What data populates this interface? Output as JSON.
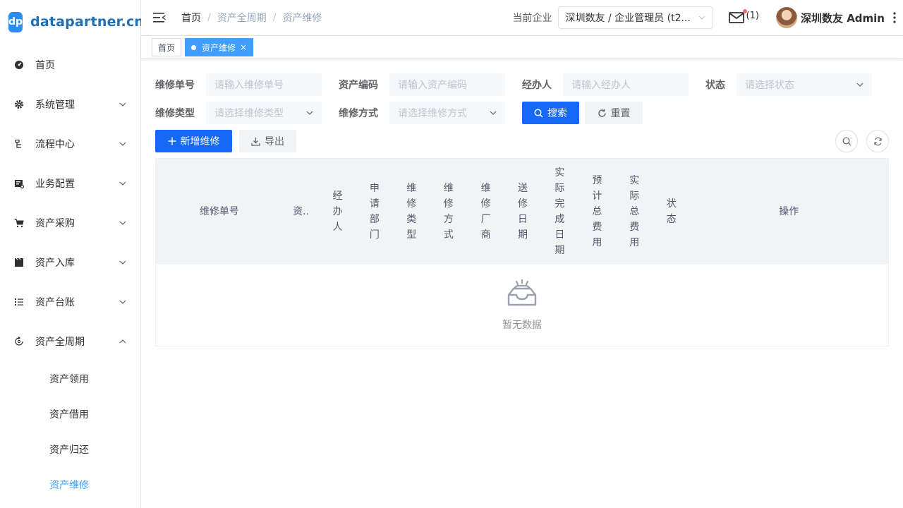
{
  "brand": {
    "mark": "dp",
    "name": "datapartner.cn"
  },
  "sidebar": {
    "items": [
      {
        "label": "首页",
        "icon": "dashboard-icon",
        "expandable": false
      },
      {
        "label": "系统管理",
        "icon": "gear-icon",
        "expandable": true
      },
      {
        "label": "流程中心",
        "icon": "flow-icon",
        "expandable": true
      },
      {
        "label": "业务配置",
        "icon": "config-icon",
        "expandable": true
      },
      {
        "label": "资产采购",
        "icon": "cart-icon",
        "expandable": true
      },
      {
        "label": "资产入库",
        "icon": "clapper-icon",
        "expandable": true
      },
      {
        "label": "资产台账",
        "icon": "list-icon",
        "expandable": true
      },
      {
        "label": "资产全周期",
        "icon": "cycle-icon",
        "expandable": true,
        "expanded": true
      }
    ],
    "subitems": [
      {
        "label": "资产领用",
        "active": false
      },
      {
        "label": "资产借用",
        "active": false
      },
      {
        "label": "资产归还",
        "active": false
      },
      {
        "label": "资产维修",
        "active": true
      }
    ]
  },
  "navbar": {
    "breadcrumb": [
      "首页",
      "资产全周期",
      "资产维修"
    ],
    "company_label": "当前企业",
    "company_value": "深圳数友 / 企业管理员 (t2...",
    "mail_count": "(1)",
    "user_name": "深圳数友 Admin"
  },
  "tags": [
    {
      "label": "首页",
      "active": false
    },
    {
      "label": "资产维修",
      "active": true,
      "close": "×"
    }
  ],
  "search": {
    "repair_no_label": "维修单号",
    "repair_no_placeholder": "请输入维修单号",
    "asset_code_label": "资产编码",
    "asset_code_placeholder": "请输入资产编码",
    "handler_label": "经办人",
    "handler_placeholder": "请输入经办人",
    "status_label": "状态",
    "status_placeholder": "请选择状态",
    "repair_type_label": "维修类型",
    "repair_type_placeholder": "请选择维修类型",
    "repair_method_label": "维修方式",
    "repair_method_placeholder": "请选择维修方式",
    "search_button": "搜索",
    "reset_button": "重置"
  },
  "toolbar": {
    "add_button": "新增维修",
    "export_button": "导出"
  },
  "table": {
    "columns": [
      "维修单号",
      "资..",
      "经办人",
      "申请部门",
      "维修类型",
      "维修方式",
      "维修厂商",
      "送修日期",
      "实际完成日期",
      "预计总费用",
      "实际总费用",
      "状态",
      "操作"
    ],
    "empty_text": "暂无数据"
  },
  "colors": {
    "primary": "#1668f7",
    "active_link": "#409eff",
    "badge": "#f56c6c"
  }
}
